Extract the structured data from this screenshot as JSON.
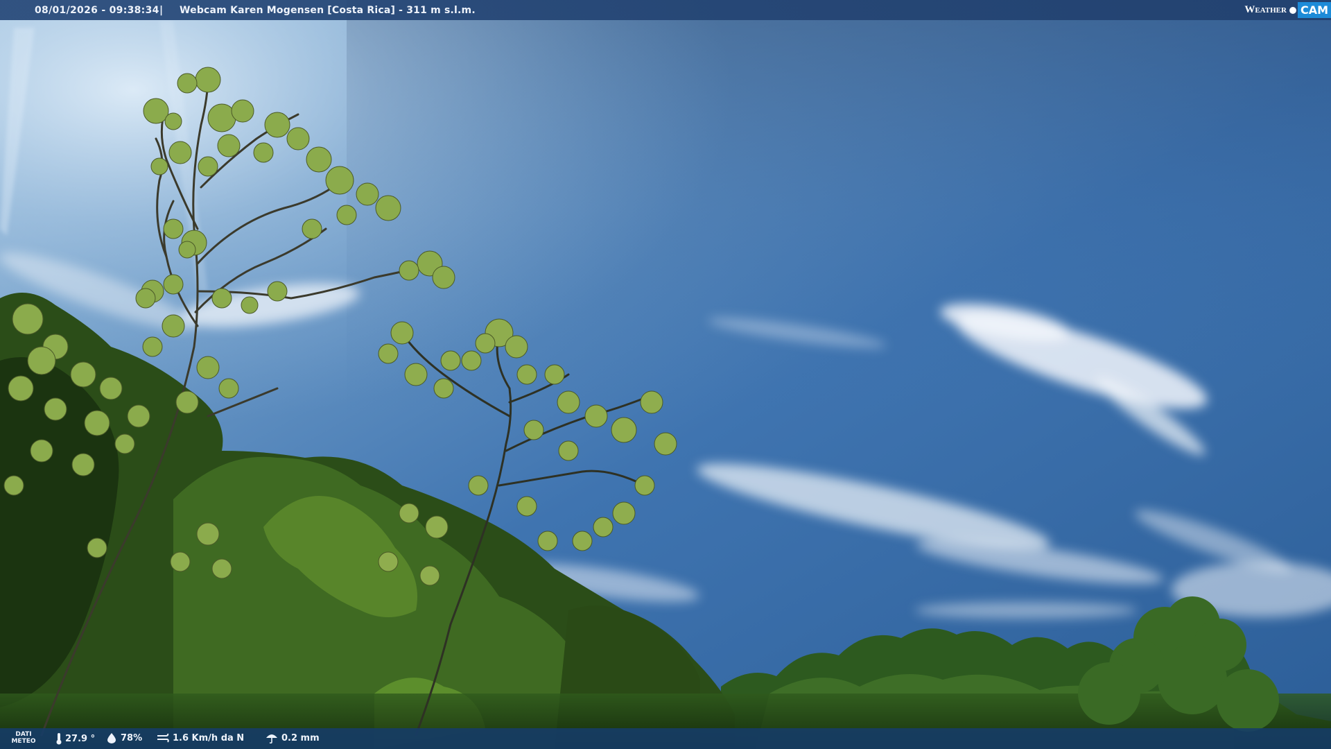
{
  "header": {
    "datetime": "08/01/2026 - 09:38:34",
    "separator": "|",
    "title": "Webcam Karen Mogensen [Costa Rica]  - 311 m s.l.m."
  },
  "logo": {
    "weather": "Weather",
    "cam": "CAM"
  },
  "footer": {
    "label_line1": "DATI",
    "label_line2": "METEO",
    "temperature": "27.9 °",
    "humidity": "78%",
    "wind": "1.6 Km/h da N",
    "rain": "0.2 mm"
  },
  "colors": {
    "sky_top": "#1f4f86",
    "sky_mid": "#3f75b0",
    "sky_bright": "#9fc3e0",
    "foliage_dark": "#1d3a12",
    "foliage_light": "#8fb04a"
  }
}
